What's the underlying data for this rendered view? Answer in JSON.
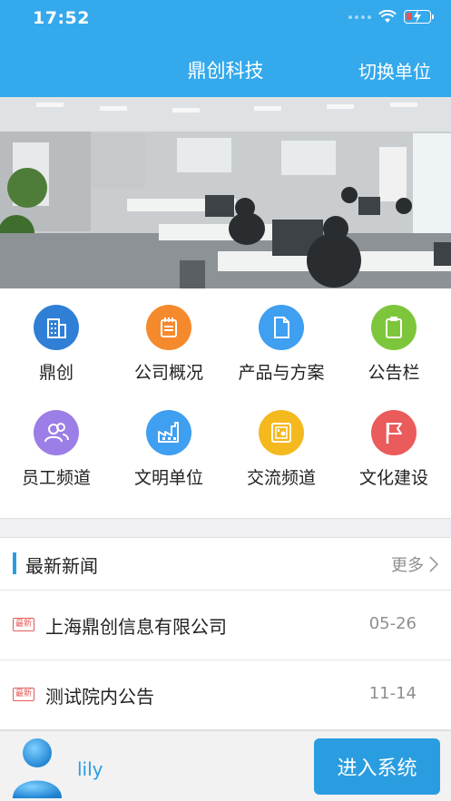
{
  "status": {
    "time": "17:52"
  },
  "nav": {
    "title": "鼎创科技",
    "switch_label": "切换单位"
  },
  "menu": [
    {
      "label": "鼎创",
      "icon": "building-icon",
      "color": "#2f7fd6"
    },
    {
      "label": "公司概况",
      "icon": "notepad-icon",
      "color": "#f58a2c"
    },
    {
      "label": "产品与方案",
      "icon": "document-icon",
      "color": "#3f9ff0"
    },
    {
      "label": "公告栏",
      "icon": "clipboard-icon",
      "color": "#7dc63b"
    },
    {
      "label": "员工频道",
      "icon": "people-icon",
      "color": "#9b7ee6"
    },
    {
      "label": "文明单位",
      "icon": "factory-icon",
      "color": "#3f9ff0"
    },
    {
      "label": "交流频道",
      "icon": "safe-icon",
      "color": "#f4b91f"
    },
    {
      "label": "文化建设",
      "icon": "flag-icon",
      "color": "#ea5b5b"
    }
  ],
  "news": {
    "title": "最新新闻",
    "more": "更多",
    "items": [
      {
        "tag": "最新",
        "title": "上海鼎创信息有限公司",
        "date": "05-26"
      },
      {
        "tag": "最新",
        "title": "测试院内公告",
        "date": "11-14"
      }
    ]
  },
  "footer": {
    "username": "lily",
    "enter_label": "进入系统"
  },
  "colors": {
    "primary": "#34a9ec",
    "accent": "#2a9de0"
  }
}
